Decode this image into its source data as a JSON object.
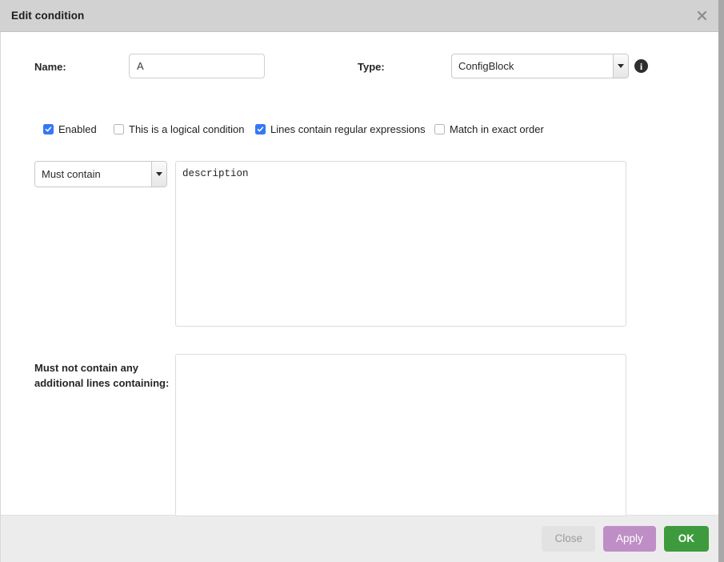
{
  "window": {
    "title": "Edit condition",
    "close_icon": "close-icon"
  },
  "form": {
    "name_label": "Name:",
    "name_value": "A",
    "name_placeholder": "",
    "type_label": "Type:",
    "type_value": "ConfigBlock",
    "info_icon": "info-icon",
    "info_glyph": "i"
  },
  "checkboxes": [
    {
      "label": "Enabled",
      "checked": true
    },
    {
      "label": "This is a logical condition",
      "checked": false
    },
    {
      "label": "Lines contain regular expressions",
      "checked": true
    },
    {
      "label": "Match in exact order",
      "checked": false
    }
  ],
  "match_rule": {
    "mode_value": "Must contain",
    "lines_value": "description",
    "lines_placeholder": ""
  },
  "exclude_rule": {
    "label_line1": "Must not contain any",
    "label_line2": "additional lines containing:",
    "value": "",
    "placeholder": ""
  },
  "footer": {
    "close_label": "Close",
    "apply_label": "Apply",
    "ok_label": "OK"
  },
  "colors": {
    "titlebar": "#d2d2d2",
    "footer": "#ececec",
    "checkbox_accent": "#3478f6",
    "apply": "#bf8ec6",
    "ok": "#3d9b3d",
    "close": "#e2e2e2"
  }
}
